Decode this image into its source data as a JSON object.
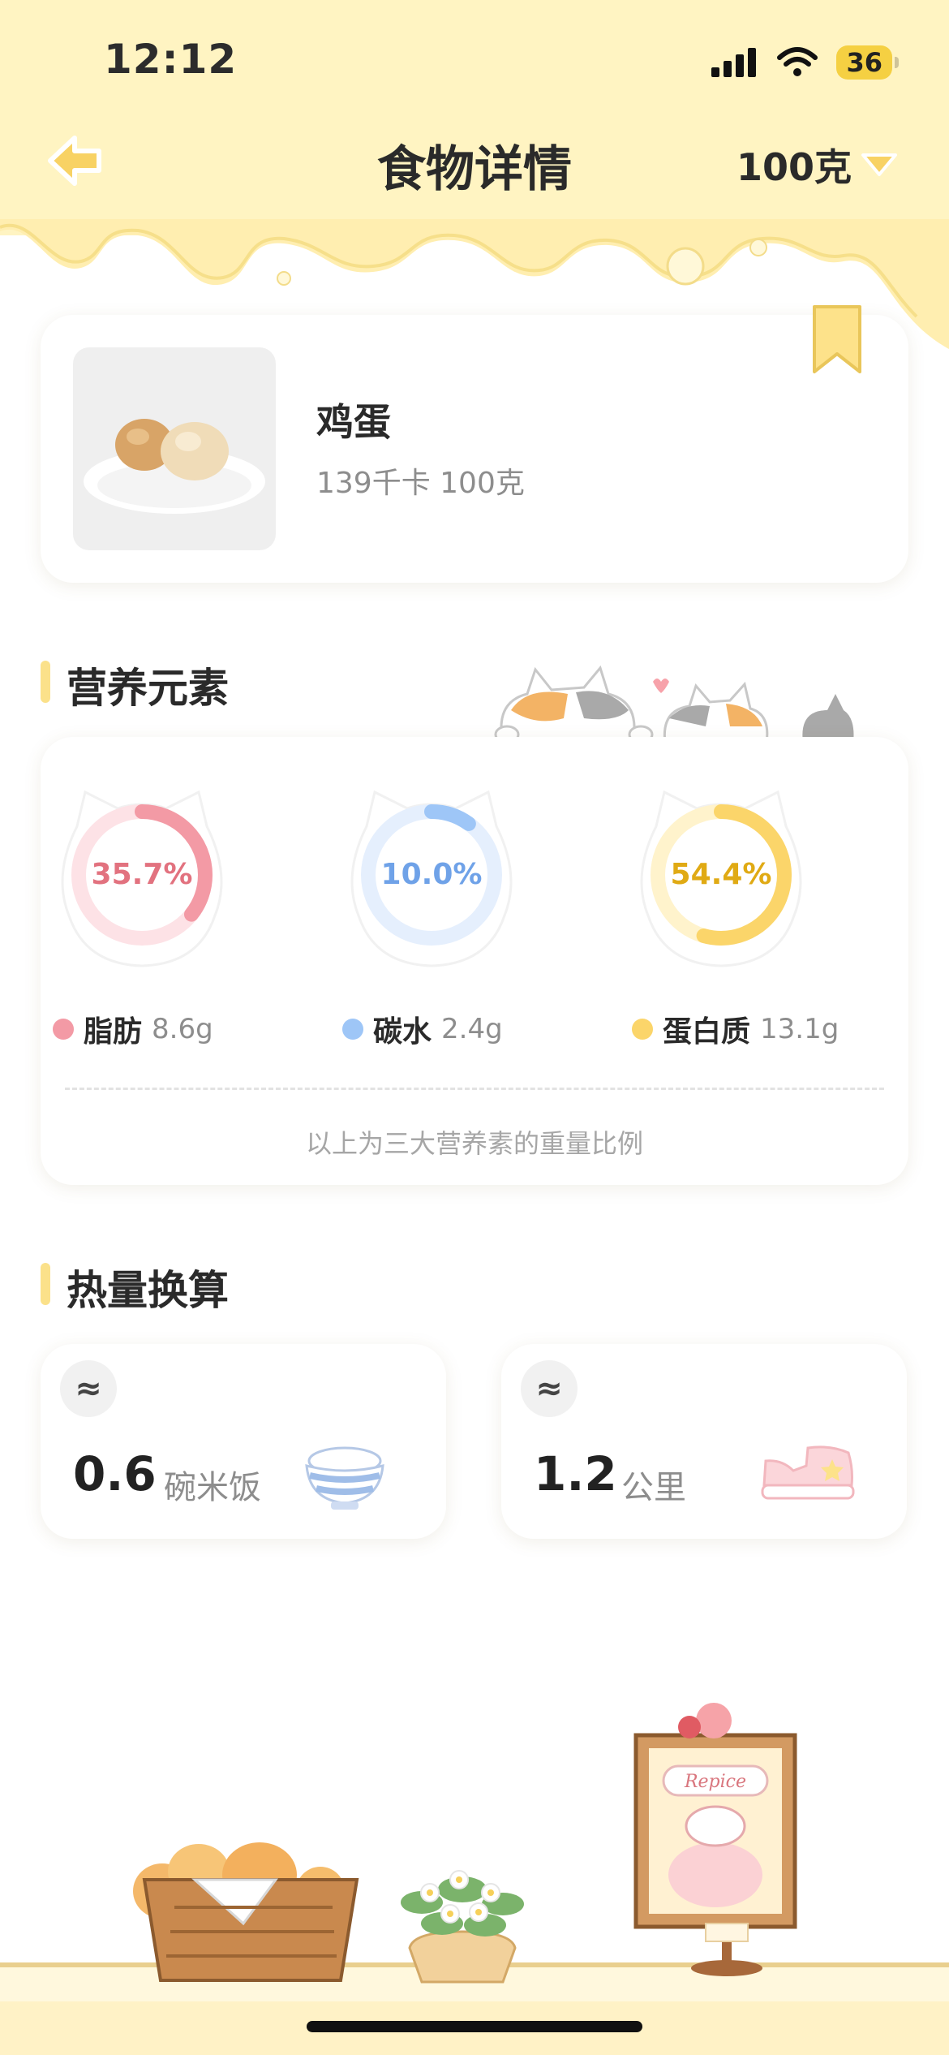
{
  "status": {
    "time": "12:12",
    "battery": "36"
  },
  "header": {
    "title": "食物详情",
    "weight": "100克"
  },
  "food": {
    "name": "鸡蛋",
    "meta": "139千卡 100克"
  },
  "nutrition": {
    "section_title": "营养元素",
    "items": [
      {
        "name": "脂肪",
        "value": "8.6g",
        "percent_label": "35.7%",
        "percent": 35.7,
        "color": "#f39aa5",
        "track": "#fde2e6",
        "text_color": "#e2727f"
      },
      {
        "name": "碳水",
        "value": "2.4g",
        "percent_label": "10.0%",
        "percent": 10.0,
        "color": "#9ec6f7",
        "track": "#e5effd",
        "text_color": "#6fa2e8"
      },
      {
        "name": "蛋白质",
        "value": "13.1g",
        "percent_label": "54.4%",
        "percent": 54.4,
        "color": "#fbd56a",
        "track": "#fff3cc",
        "text_color": "#e0aa14"
      }
    ],
    "note": "以上为三大营养素的重量比例"
  },
  "calories": {
    "section_title": "热量换算",
    "approx_symbol": "≈",
    "items": [
      {
        "value": "0.6",
        "unit": "碗米饭",
        "icon": "rice-bowl-icon"
      },
      {
        "value": "1.2",
        "unit": "公里",
        "icon": "sneaker-icon"
      }
    ]
  },
  "decor": {
    "sign_text": "Repice"
  },
  "colors": {
    "accent_yellow": "#fbe18a",
    "header_bg": "#fff4c2",
    "drip": "#ffeeb0"
  }
}
